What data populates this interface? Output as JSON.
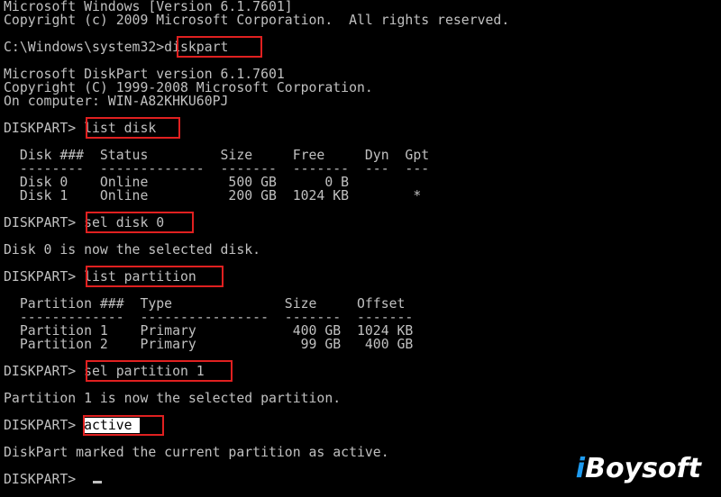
{
  "console": {
    "banner_line1": "Microsoft Windows [Version 6.1.7601]",
    "banner_line2": "Copyright (c) 2009 Microsoft Corporation.  All rights reserved.",
    "prompt_system32": "C:\\Windows\\system32>",
    "cmd_diskpart": "diskpart",
    "dp_line1": "Microsoft DiskPart version 6.1.7601",
    "dp_line2": "Copyright (C) 1999-2008 Microsoft Corporation.",
    "dp_line3": "On computer: WIN-A82KHKU60PJ",
    "diskpart_prompt": "DISKPART> ",
    "cmd_list_disk": "list disk",
    "disk_header": "  Disk ###  Status         Size     Free     Dyn  Gpt",
    "disk_separator": "  --------  -------------  -------  -------  ---  ---",
    "disk_rows": [
      "  Disk 0    Online          500 GB      0 B",
      "  Disk 1    Online          200 GB  1024 KB        *"
    ],
    "cmd_sel_disk": "sel disk 0",
    "msg_disk_selected": "Disk 0 is now the selected disk.",
    "cmd_list_partition": "list partition",
    "part_header": "  Partition ###  Type              Size     Offset",
    "part_separator": "  -------------  ----------------  -------  -------",
    "part_rows": [
      "  Partition 1    Primary            400 GB  1024 KB",
      "  Partition 2    Primary             99 GB   400 GB"
    ],
    "cmd_sel_partition": "sel partition 1",
    "msg_partition_selected": "Partition 1 is now the selected partition.",
    "cmd_active": "active",
    "msg_active": "DiskPart marked the current partition as active."
  },
  "watermark": {
    "text_prefix": "i",
    "text_rest": "Boysoft"
  },
  "colors": {
    "background": "#000000",
    "text": "#c0c0c0",
    "highlight_box": "#e02020",
    "selection_bg": "#ffffff",
    "watermark_dot": "#1e9bf0"
  }
}
